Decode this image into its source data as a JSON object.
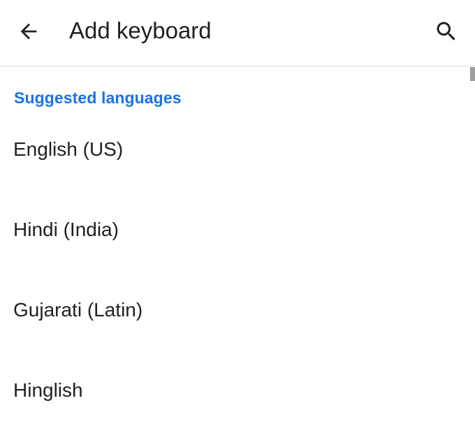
{
  "header": {
    "title": "Add keyboard",
    "back_icon": "arrow-back-icon",
    "search_icon": "search-icon"
  },
  "section": {
    "title": "Suggested languages",
    "color": "#1a73e8"
  },
  "languages": [
    {
      "label": "English (US)"
    },
    {
      "label": "Hindi (India)"
    },
    {
      "label": "Gujarati (Latin)"
    },
    {
      "label": "Hinglish"
    }
  ]
}
